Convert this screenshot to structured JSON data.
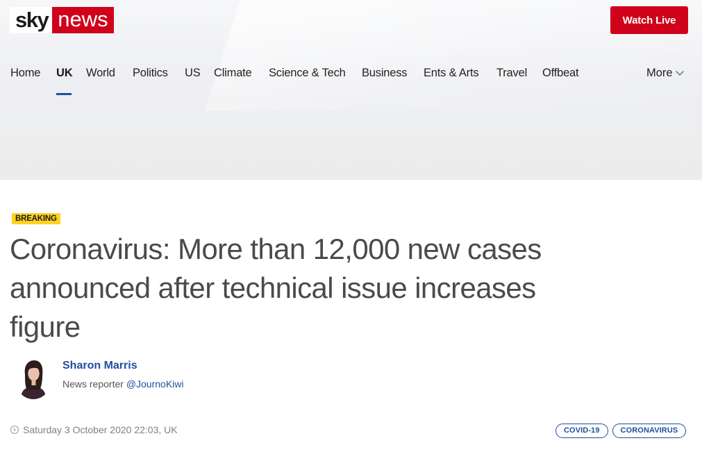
{
  "header": {
    "logo_sky": "sky",
    "logo_news": "news",
    "watch_live": "Watch Live"
  },
  "nav": {
    "items": [
      "Home",
      "UK",
      "World",
      "Politics",
      "US",
      "Climate",
      "Science & Tech",
      "Business",
      "Ents & Arts",
      "Travel",
      "Offbeat"
    ],
    "active": "UK",
    "more": "More"
  },
  "article": {
    "badge": "BREAKING",
    "headline": "Coronavirus: More than 12,000 new cases announced after technical issue increases figure",
    "author": {
      "name": "Sharon Marris",
      "role": "News reporter",
      "handle": "@JournoKiwi"
    },
    "date": "Saturday 3 October 2020 22:03, UK",
    "tags": [
      "COVID-19",
      "CORONAVIRUS"
    ]
  },
  "colors": {
    "brand_red": "#d0021b",
    "link_blue": "#1f4e9c",
    "breaking_yellow": "#ffd21f"
  }
}
